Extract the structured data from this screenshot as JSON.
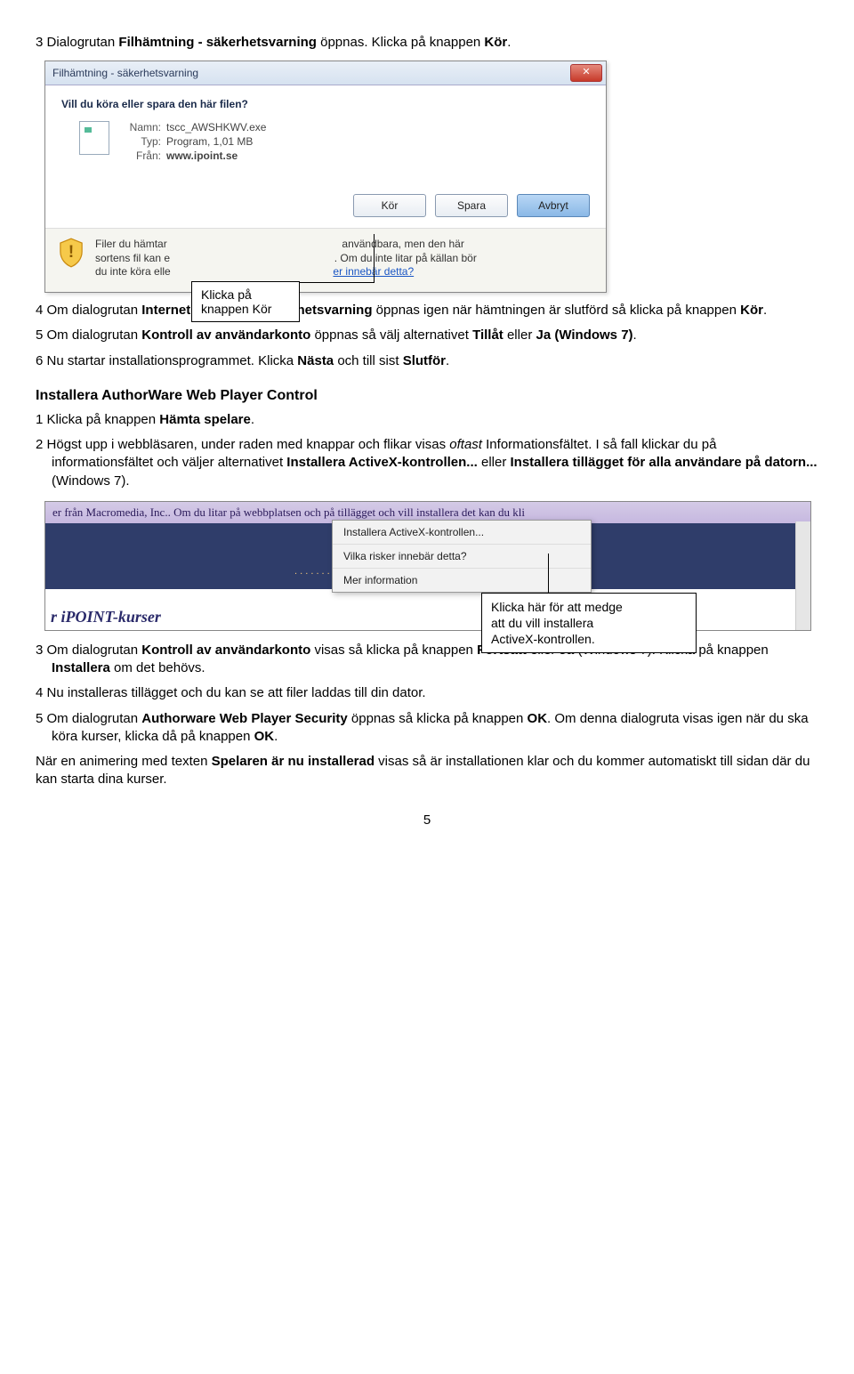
{
  "step3": {
    "num": "3",
    "text_a": "Dialogrutan ",
    "bold1": "Filhämtning - säkerhetsvarning",
    "text_b": " öppnas. Klicka på knappen ",
    "bold2": "Kör",
    "text_c": "."
  },
  "dialog1": {
    "title": "Filhämtning - säkerhetsvarning",
    "question": "Vill du köra eller spara den här filen?",
    "name_label": "Namn:",
    "name_value": "tscc_AWSHKWV.exe",
    "type_label": "Typ:",
    "type_value": "Program, 1,01 MB",
    "from_label": "Från:",
    "from_value": "www.ipoint.se",
    "btn_run": "Kör",
    "btn_save": "Spara",
    "btn_cancel": "Avbryt",
    "footer_a": "Filer du hämtar",
    "footer_b": "sortens fil kan e",
    "footer_c": "du inte köra elle",
    "footer_d": "användbara, men den här",
    "footer_e": ". Om du inte litar på källan bör",
    "footer_link": "er innebär detta?"
  },
  "callout1": {
    "line1": "Klicka på",
    "line2": "knappen Kör"
  },
  "step4": {
    "num": "4",
    "text_a": "Om dialogrutan ",
    "bold1": "Internet Explorer - Säkerhetsvarning",
    "text_b": " öppnas igen när hämtningen är slutförd så klicka på knappen ",
    "bold2": "Kör",
    "text_c": "."
  },
  "step5": {
    "num": "5",
    "text_a": "Om dialogrutan ",
    "bold1": "Kontroll av användarkonto",
    "text_b": " öppnas så välj alternativet ",
    "bold2": "Tillåt",
    "text_c": " eller ",
    "bold3": "Ja (Windows 7)",
    "text_d": "."
  },
  "step6": {
    "num": "6",
    "text_a": "Nu startar installationsprogrammet. Klicka ",
    "bold1": "Nästa",
    "text_b": " och till sist ",
    "bold2": "Slutför",
    "text_c": "."
  },
  "heading": "Installera AuthorWare Web Player Control",
  "b_step1": {
    "num": "1",
    "text_a": "Klicka på knappen ",
    "bold1": "Hämta spelare",
    "text_b": "."
  },
  "b_step2": {
    "num": "2",
    "text_a": "Högst upp i webbläsaren, under raden med knappar och flikar visas ",
    "italic1": "oftast",
    "text_b": " Informations­fältet. I så fall klickar du på informationsfältet och väljer alternativet ",
    "bold1": "Installera ActiveX-kontrollen...",
    "text_c": " eller ",
    "bold2": "Installera tillägget för alla användare på datorn...",
    "text_d": " (Windows 7)."
  },
  "screenshot2": {
    "topbar": "er från Macromedia, Inc.. Om du litar på webbplatsen och på tillägget och vill installera det kan du kli",
    "dots": ". . . . . . . . . . . . . . . . . . . . . . . . . . . . . . . . . . . . . .",
    "menu1": "Installera ActiveX-kontrollen...",
    "menu2": "Vilka risker innebär detta?",
    "menu3": "Mer information",
    "brand": "r iPOINT-kurser"
  },
  "callout2": {
    "line1": "Klicka här för att medge",
    "line2": "att du vill installera",
    "line3": "ActiveX-kontrollen."
  },
  "c_step3": {
    "num": "3",
    "text_a": "Om dialogrutan ",
    "bold1": "Kontroll av användarkonto",
    "text_b": " visas så klicka på knappen ",
    "bold2": "Fortsätt",
    "text_c": " eller ",
    "bold3": "Ja",
    "text_d": " (Windows 7). Klicka på knappen ",
    "bold4": "Installera",
    "text_e": " om det behövs."
  },
  "c_step4": {
    "num": "4",
    "text": "Nu installeras tillägget och du kan se att filer laddas till din dator."
  },
  "c_step5": {
    "num": "5",
    "text_a": "Om dialogrutan ",
    "bold1": "Authorware Web Player Security",
    "text_b": " öppnas så klicka på knappen ",
    "bold2": "OK",
    "text_c": ". Om denna dialogruta visas igen när du ska köra kurser, klicka då på knappen ",
    "bold3": "OK",
    "text_d": "."
  },
  "final": {
    "text_a": "När en animering med texten ",
    "bold1": "Spelaren är nu installerad",
    "text_b": " visas så är installationen klar och du kommer automatiskt till sidan där du kan starta dina kurser."
  },
  "pagenum": "5"
}
